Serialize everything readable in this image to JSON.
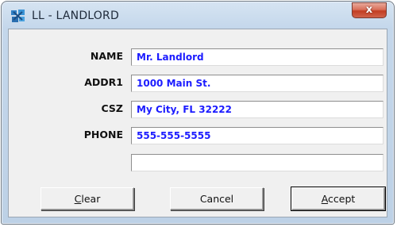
{
  "window": {
    "title": "LL - LANDLORD",
    "close_symbol": "x"
  },
  "form": {
    "fields": [
      {
        "label": "NAME",
        "value": "Mr. Landlord"
      },
      {
        "label": "ADDR1",
        "value": "1000 Main St."
      },
      {
        "label": "CSZ",
        "value": "My City, FL 32222"
      },
      {
        "label": "PHONE",
        "value": "555-555-5555"
      },
      {
        "label": "",
        "value": ""
      }
    ]
  },
  "buttons": {
    "clear": {
      "mnemonic": "C",
      "rest": "lear"
    },
    "cancel": {
      "label": "Cancel"
    },
    "accept": {
      "mnemonic": "A",
      "rest": "ccept"
    }
  },
  "colors": {
    "field_text": "#1c1cff",
    "title_bar": "#c4d7eb",
    "close_button": "#c23d22"
  },
  "icons": {
    "app": "landlord-app-icon",
    "close": "close-icon"
  }
}
